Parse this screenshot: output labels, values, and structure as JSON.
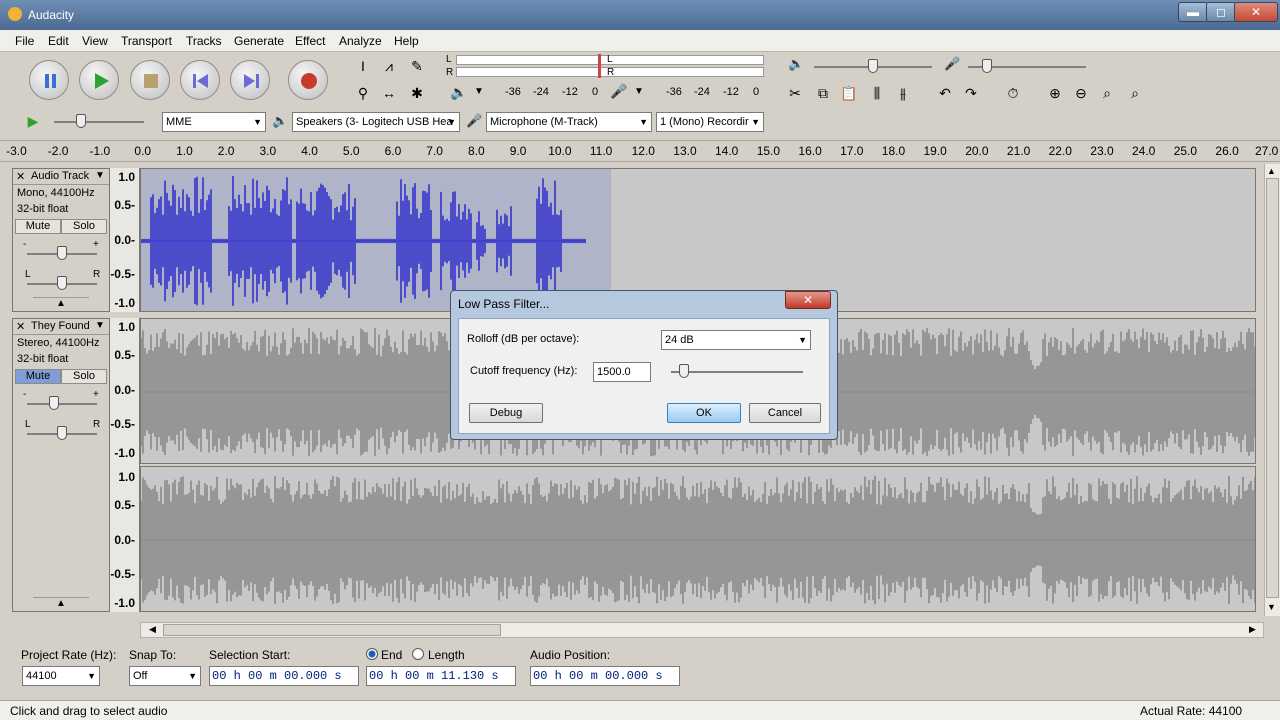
{
  "app": {
    "title": "Audacity"
  },
  "window_buttons": {
    "minimize": "▬",
    "maximize": "◻",
    "close": "✕"
  },
  "menu": [
    "File",
    "Edit",
    "View",
    "Transport",
    "Tracks",
    "Generate",
    "Effect",
    "Analyze",
    "Help"
  ],
  "meters": {
    "play_ticks": [
      "-36",
      "-24",
      "-12",
      "0"
    ],
    "rec_ticks": [
      "-36",
      "-24",
      "-12",
      "0"
    ],
    "L": "L",
    "R": "R"
  },
  "device_toolbar": {
    "host": "MME",
    "output": "Speakers (3- Logitech USB Hea",
    "input": "Microphone (M-Track)",
    "channels": "1 (Mono) Recordir"
  },
  "ruler": {
    "ticks": [
      "-3.0",
      "-2.0",
      "-1.0",
      "0.0",
      "1.0",
      "2.0",
      "3.0",
      "4.0",
      "5.0",
      "6.0",
      "7.0",
      "8.0",
      "9.0",
      "10.0",
      "11.0",
      "12.0",
      "13.0",
      "14.0",
      "15.0",
      "16.0",
      "17.0",
      "18.0",
      "19.0",
      "20.0",
      "21.0",
      "22.0",
      "23.0",
      "24.0",
      "25.0",
      "26.0",
      "27.0"
    ]
  },
  "tracks": [
    {
      "name": "Audio Track",
      "info1": "Mono, 44100Hz",
      "info2": "32-bit float",
      "mute": "Mute",
      "solo": "Solo",
      "scale": [
        "1.0",
        "0.5-",
        "0.0-",
        "-0.5-",
        "-1.0"
      ],
      "pan_l": "L",
      "pan_r": "R",
      "gain_minus": "-",
      "gain_plus": "+"
    },
    {
      "name": "They Found",
      "info1": "Stereo, 44100Hz",
      "info2": "32-bit float",
      "mute": "Mute",
      "solo": "Solo",
      "scale": [
        "1.0",
        "0.5-",
        "0.0-",
        "-0.5-",
        "-1.0"
      ],
      "scale2": [
        "1.0",
        "0.5-",
        "0.0-",
        "-0.5-",
        "-1.0"
      ],
      "pan_l": "L",
      "pan_r": "R",
      "gain_minus": "-",
      "gain_plus": "+"
    }
  ],
  "dialog": {
    "title": "Low Pass Filter...",
    "rolloff_label": "Rolloff (dB per octave):",
    "rolloff_value": "24 dB",
    "cutoff_label": "Cutoff frequency (Hz):",
    "cutoff_value": "1500.0",
    "debug": "Debug",
    "ok": "OK",
    "cancel": "Cancel",
    "close": "✕"
  },
  "selection_toolbar": {
    "project_rate_label": "Project Rate (Hz):",
    "project_rate": "44100",
    "snap_label": "Snap To:",
    "snap_value": "Off",
    "sel_start_label": "Selection Start:",
    "sel_start": "00 h 00 m 00.000 s",
    "end_label": "End",
    "length_label": "Length",
    "sel_end": "00 h 00 m 11.130 s",
    "audio_pos_label": "Audio Position:",
    "audio_pos": "00 h 00 m 00.000 s"
  },
  "status": {
    "left": "Click and drag to select audio",
    "right": "Actual Rate: 44100"
  },
  "colors": {
    "mono_wave": "#3333cc",
    "stereo_wave": "#8a8a8a",
    "selection": "#b0b4c8"
  }
}
